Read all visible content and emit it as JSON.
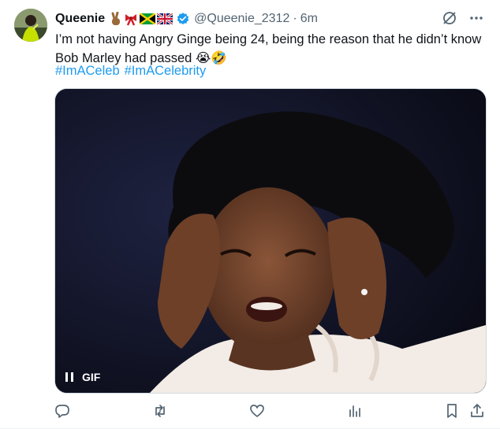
{
  "tweet": {
    "display_name": "Queenie",
    "handle": "@Queenie_2312",
    "separator": "·",
    "time": "6m",
    "text": "I’m not having Angry Ginge being 24, being the reason that he didn’t know Bob Marley had passed 😭🤣",
    "hashtags": [
      "#ImACeleb",
      "#ImACelebrity"
    ],
    "name_emojis": [
      "victory-hand-icon",
      "ribbon-icon",
      "jamaica-flag-icon",
      "uk-flag-icon"
    ]
  },
  "media": {
    "badge": "GIF",
    "description_icon": "pause-icon"
  },
  "actions": [
    "reply-icon",
    "retweet-icon",
    "like-icon",
    "views-icon",
    "bookmark-icon",
    "share-icon"
  ],
  "colors": {
    "link": "#1d9bf0",
    "muted": "#536471",
    "verified": "#1d9bf0"
  }
}
